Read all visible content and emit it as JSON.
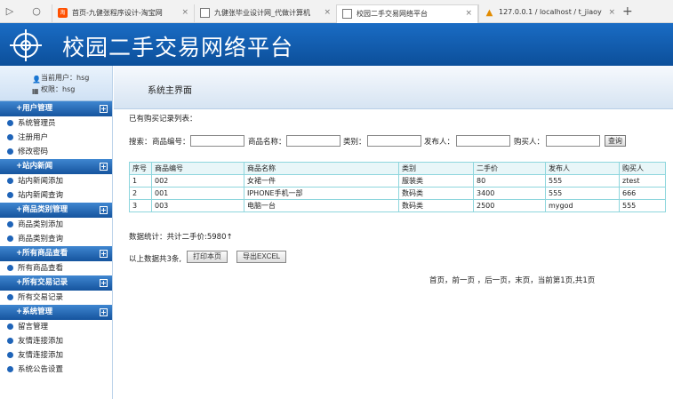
{
  "browser": {
    "tabs": [
      {
        "title": "首页-九健张程序设计-淘宝网",
        "icon": "taobao-icon",
        "active": false
      },
      {
        "title": "九健张毕业设计网_代做计算机",
        "icon": "page-icon",
        "active": false
      },
      {
        "title": "校园二手交易网络平台",
        "icon": "page-icon",
        "active": true
      },
      {
        "title": "127.0.0.1 / localhost / t_jiaoy",
        "icon": "database-icon",
        "active": false
      }
    ],
    "new_tab": "+"
  },
  "header": {
    "site_title": "校园二手交易网络平台"
  },
  "user": {
    "current_user": "当前用户：hsg",
    "role": "权限：hsg"
  },
  "sidebar": {
    "groups": [
      {
        "title": "+用户管理",
        "items": [
          "系统管理员",
          "注册用户",
          "修改密码"
        ]
      },
      {
        "title": "+站内新闻",
        "items": [
          "站内新闻添加",
          "站内新闻查询"
        ]
      },
      {
        "title": "+商品类别管理",
        "items": [
          "商品类别添加",
          "商品类别查询"
        ]
      },
      {
        "title": "+所有商品查看",
        "items": [
          "所有商品查看"
        ]
      },
      {
        "title": "+所有交易记录",
        "items": [
          "所有交易记录"
        ]
      },
      {
        "title": "+系统管理",
        "items": [
          "留言管理",
          "友情连接添加",
          "友情连接添加",
          "系统公告设置"
        ]
      }
    ]
  },
  "main": {
    "page_title": "系统主界面",
    "list_caption": "已有购买记录列表：",
    "search": {
      "prefix": "搜索：",
      "product_no_label": "商品编号：",
      "product_name_label": "商品名称：",
      "category_label": "类别：",
      "publisher_label": "发布人：",
      "buyer_label": "购买人：",
      "button": "查询"
    },
    "table": {
      "columns": [
        "序号",
        "商品编号",
        "商品名称",
        "类别",
        "二手价",
        "发布人",
        "购买人"
      ],
      "rows": [
        [
          "1",
          "002",
          "女裙一件",
          "服装类",
          "80",
          "555",
          "ztest"
        ],
        [
          "2",
          "001",
          "IPHONE手机一部",
          "数码类",
          "3400",
          "555",
          "666"
        ],
        [
          "3",
          "003",
          "电脑一台",
          "数码类",
          "2500",
          "mygod",
          "555"
        ]
      ]
    },
    "stats": "数据统计：共计二手价:5980↑",
    "summary": "以上数据共3条,",
    "print_button": "打印本页",
    "export_button": "导出EXCEL",
    "pager": "首页，前一页 ，后一页，末页，当前第1页,共1页"
  }
}
